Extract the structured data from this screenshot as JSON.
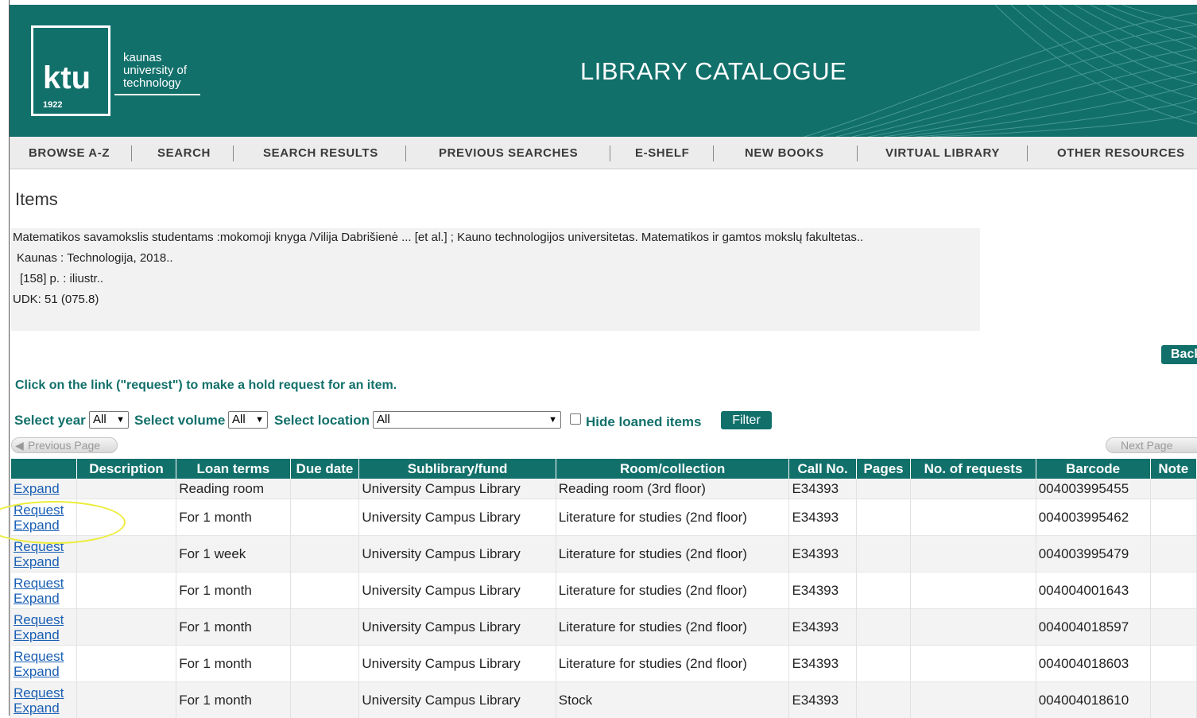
{
  "header": {
    "logo_text": "ktu",
    "logo_year": "1922",
    "logo_sub": [
      "kaunas",
      "university of",
      "technology"
    ],
    "title": "LIBRARY CATALOGUE"
  },
  "nav": [
    "BROWSE A-Z",
    "SEARCH",
    "SEARCH RESULTS",
    "PREVIOUS SEARCHES",
    "E-SHELF",
    "NEW BOOKS",
    "VIRTUAL LIBRARY",
    "OTHER RESOURCES"
  ],
  "page_heading": "Items",
  "bib": [
    "Matematikos savamokslis studentams :mokomoji knyga /Vilija Dabrišienė ... [et al.] ; Kauno technologijos universitetas. Matematikos ir gamtos mokslų fakultetas..",
    " Kaunas : Technologija, 2018..",
    "  [158] p. :  iliustr..",
    "UDK: 51 (075.8)"
  ],
  "back_label": "Back",
  "hold_message": "Click on the link (\"request\") to make a hold request for an item.",
  "filters": {
    "year_label": "Select year",
    "year_value": "All",
    "volume_label": "Select volume",
    "volume_value": "All",
    "location_label": "Select location",
    "location_value": "All",
    "hide_loaned_label": "Hide loaned items",
    "filter_button": "Filter"
  },
  "paging": {
    "previous": "Previous Page",
    "next": "Next Page"
  },
  "table": {
    "headers": [
      "",
      "Description",
      "Loan terms",
      "Due date",
      "Sublibrary/fund",
      "Room/collection",
      "Call No.",
      "Pages",
      "No. of requests",
      "Barcode",
      "Note"
    ],
    "request_label": "Request",
    "expand_label": "Expand",
    "rows": [
      {
        "loan": "Reading room",
        "sublib": "University Campus Library",
        "room": "Reading room (3rd floor)",
        "call": "E34393",
        "barcode": "004003995455"
      },
      {
        "loan": "For 1 month",
        "sublib": "University Campus Library",
        "room": "Literature for studies (2nd floor)",
        "call": "E34393",
        "barcode": "004003995462"
      },
      {
        "loan": "For 1 week",
        "sublib": "University Campus Library",
        "room": "Literature for studies (2nd floor)",
        "call": "E34393",
        "barcode": "004003995479"
      },
      {
        "loan": "For 1 month",
        "sublib": "University Campus Library",
        "room": "Literature for studies (2nd floor)",
        "call": "E34393",
        "barcode": "004004001643"
      },
      {
        "loan": "For 1 month",
        "sublib": "University Campus Library",
        "room": "Literature for studies (2nd floor)",
        "call": "E34393",
        "barcode": "004004018597"
      },
      {
        "loan": "For 1 month",
        "sublib": "University Campus Library",
        "room": "Literature for studies (2nd floor)",
        "call": "E34393",
        "barcode": "004004018603"
      },
      {
        "loan": "For 1 month",
        "sublib": "University Campus Library",
        "room": "Stock",
        "call": "E34393",
        "barcode": "004004018610"
      }
    ]
  }
}
